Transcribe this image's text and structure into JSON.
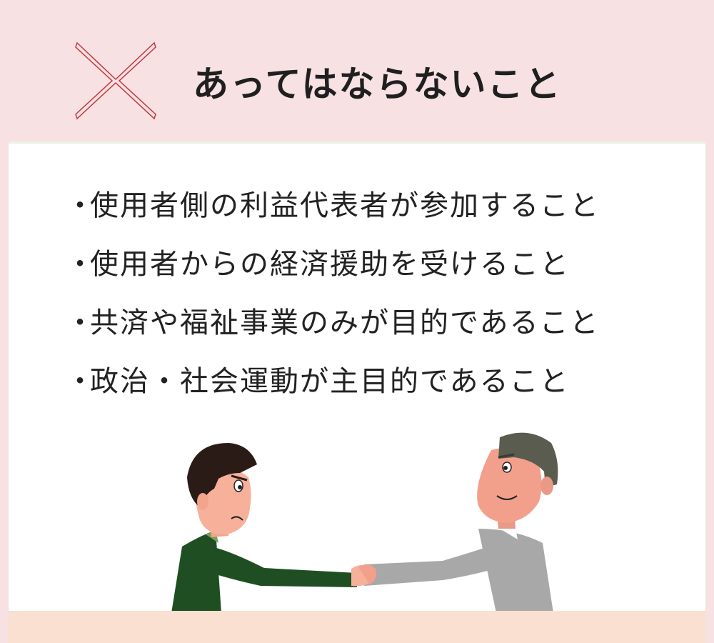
{
  "header": {
    "icon": "cross-icon",
    "icon_color": "#c0393f",
    "title": "あってはならないこと"
  },
  "list": {
    "bullet": "・",
    "items": [
      "使用者側の利益代表者が参加すること",
      "使用者からの経済援助を受けること",
      "共済や福祉事業のみが目的であること",
      "政治・社会運動が主目的であること"
    ]
  },
  "colors": {
    "background": "#f7e1e2",
    "panel": "#ffffff",
    "floor": "#f9e0d1",
    "left_person_shirt": "#1f4e22",
    "right_person_shirt": "#a8a8a8"
  },
  "illustration": {
    "name": "handshake-illustration"
  }
}
